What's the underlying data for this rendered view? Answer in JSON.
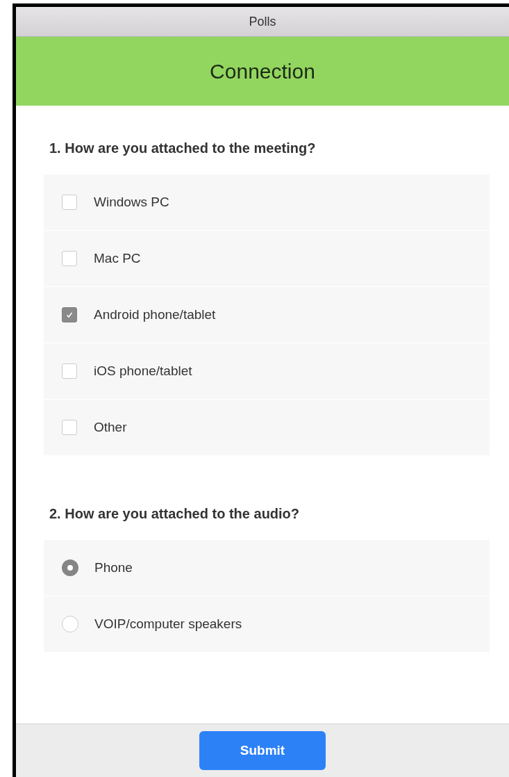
{
  "window": {
    "title": "Polls"
  },
  "header": {
    "title": "Connection"
  },
  "questions": [
    {
      "text": "1. How are you attached to the meeting?",
      "kind": "checkbox",
      "options": [
        {
          "label": "Windows PC",
          "checked": false
        },
        {
          "label": "Mac PC",
          "checked": false
        },
        {
          "label": "Android phone/tablet",
          "checked": true
        },
        {
          "label": "iOS phone/tablet",
          "checked": false
        },
        {
          "label": "Other",
          "checked": false
        }
      ]
    },
    {
      "text": "2. How are you attached to the audio?",
      "kind": "radio",
      "options": [
        {
          "label": "Phone",
          "selected": true
        },
        {
          "label": "VOIP/computer speakers",
          "selected": false
        }
      ]
    }
  ],
  "footer": {
    "button": "Submit"
  }
}
